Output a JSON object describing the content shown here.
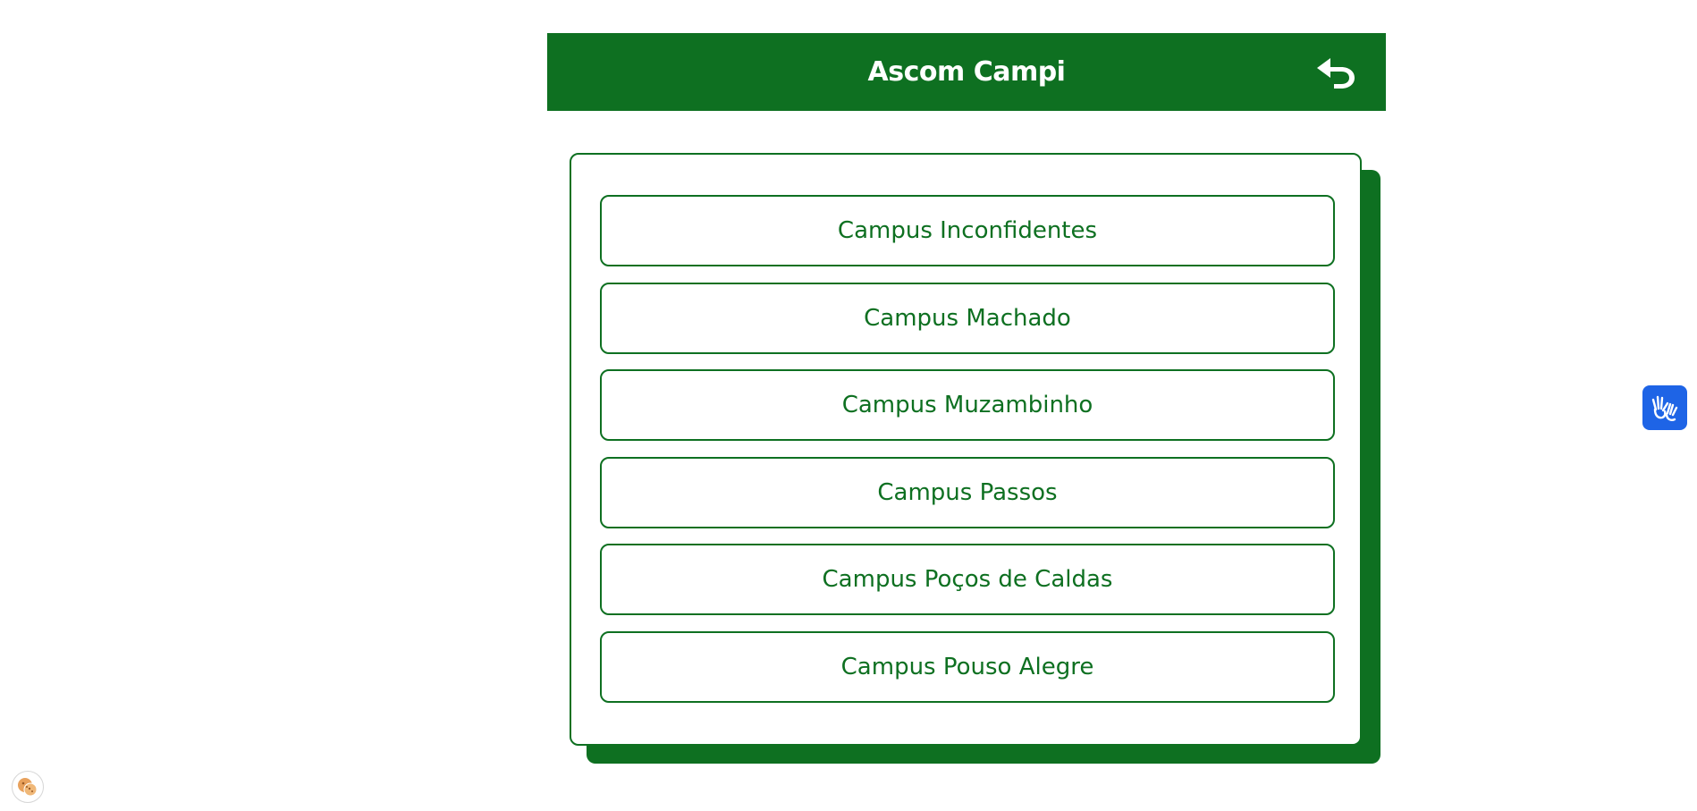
{
  "header": {
    "title": "Ascom Campi",
    "back_icon": "undo-arrow-icon"
  },
  "campus_list": [
    {
      "label": "Campus Inconfidentes"
    },
    {
      "label": "Campus Machado"
    },
    {
      "label": "Campus Muzambinho"
    },
    {
      "label": "Campus Passos"
    },
    {
      "label": "Campus Poços de Caldas"
    },
    {
      "label": "Campus Pouso Alegre"
    }
  ],
  "widgets": {
    "accessibility_icon": "sign-language-hands-icon",
    "cookie_icon": "cookie-icon"
  },
  "colors": {
    "primary_green": "#0e7021",
    "accessibility_blue": "#1e64e6",
    "background": "#ffffff"
  }
}
